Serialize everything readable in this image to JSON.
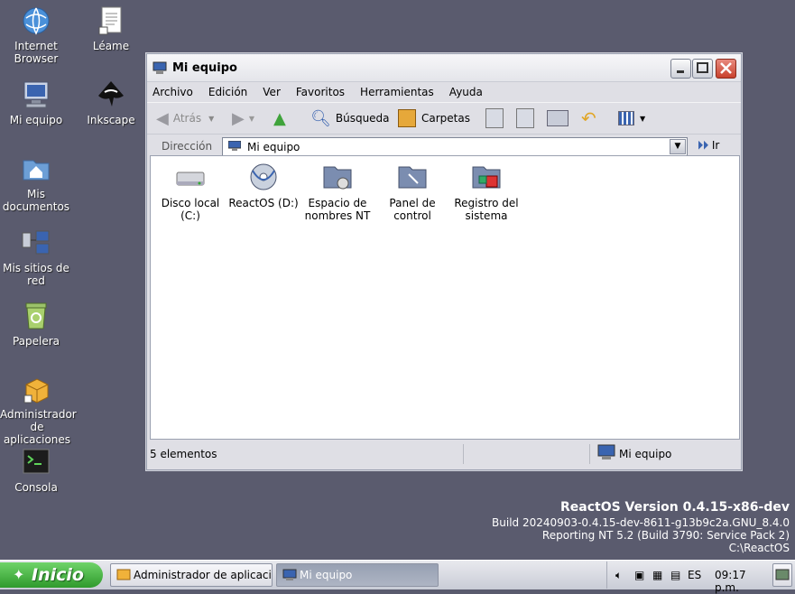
{
  "desktop_icons": [
    {
      "label": "Internet Browser",
      "icon": "globe-icon"
    },
    {
      "label": "Léame",
      "icon": "document-icon"
    },
    {
      "label": "Mi equipo",
      "icon": "computer-icon"
    },
    {
      "label": "Inkscape",
      "icon": "inkscape-icon"
    },
    {
      "label": "Mis documentos",
      "icon": "folder-home-icon"
    },
    {
      "label": "Mis sitios de red",
      "icon": "network-icon"
    },
    {
      "label": "Papelera",
      "icon": "recycle-bin-icon"
    },
    {
      "label": "Administrador de aplicaciones",
      "icon": "package-icon"
    },
    {
      "label": "Consola",
      "icon": "console-icon"
    }
  ],
  "window": {
    "title": "Mi equipo",
    "menu": [
      "Archivo",
      "Edición",
      "Ver",
      "Favoritos",
      "Herramientas",
      "Ayuda"
    ],
    "toolbar": {
      "back": "Atrás",
      "search": "Búsqueda",
      "folders": "Carpetas"
    },
    "address": {
      "label": "Dirección",
      "value": "Mi equipo",
      "go": "Ir"
    },
    "items": [
      {
        "label": "Disco local (C:)",
        "icon": "drive-icon"
      },
      {
        "label": "ReactOS (D:)",
        "icon": "cdrom-icon"
      },
      {
        "label": "Espacio de nombres NT",
        "icon": "nt-namespace-folder-icon"
      },
      {
        "label": "Panel de control",
        "icon": "control-panel-icon"
      },
      {
        "label": "Registro del sistema",
        "icon": "registry-icon"
      }
    ],
    "status": {
      "count": "5 elementos",
      "location": "Mi equipo"
    }
  },
  "version": {
    "line1": "ReactOS Version 0.4.15-x86-dev",
    "line2": "Build 20240903-0.4.15-dev-8611-g13b9c2a.GNU_8.4.0",
    "line3": "Reporting NT 5.2 (Build 3790: Service Pack 2)",
    "line4": "C:\\ReactOS"
  },
  "taskbar": {
    "start": "Inicio",
    "tasks": [
      {
        "label": "Administrador de aplicacion..."
      },
      {
        "label": "Mi equipo"
      }
    ],
    "language": "ES",
    "clock": "09:17 p.m."
  },
  "colors": {
    "desktop": "#5a5b6e",
    "start_button": "#3da83a",
    "close_button": "#c8412d"
  }
}
